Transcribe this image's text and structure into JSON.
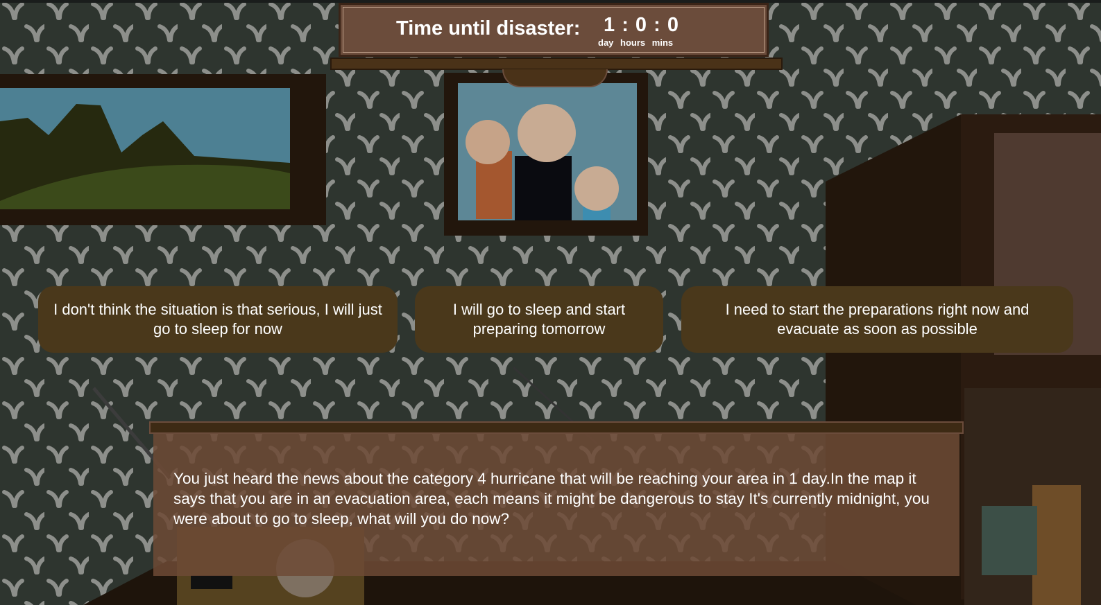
{
  "timer": {
    "title": "Time until disaster:",
    "day": "1",
    "hours": "0",
    "mins": "0",
    "unit_day": "day",
    "unit_hours": "hours",
    "unit_mins": "mins"
  },
  "choices": [
    {
      "label": "I don't think the situation is that serious, I will just go to sleep for now"
    },
    {
      "label": "I will go to sleep and start preparing tomorrow"
    },
    {
      "label": "I need to start the preparations right now and evacuate as soon as possible"
    }
  ],
  "story": {
    "text": "You just heard the news about the category 4 hurricane that will be reaching your area in 1 day.In the map it says that you are in an evacuation area, each means it might be dangerous to stay It's currently midnight, you were about to go to sleep, what will you do now?"
  },
  "colors": {
    "choice_bg": "#4a381b",
    "panel_bg": "#6e4a36",
    "wallpaper": "#2b302b"
  }
}
